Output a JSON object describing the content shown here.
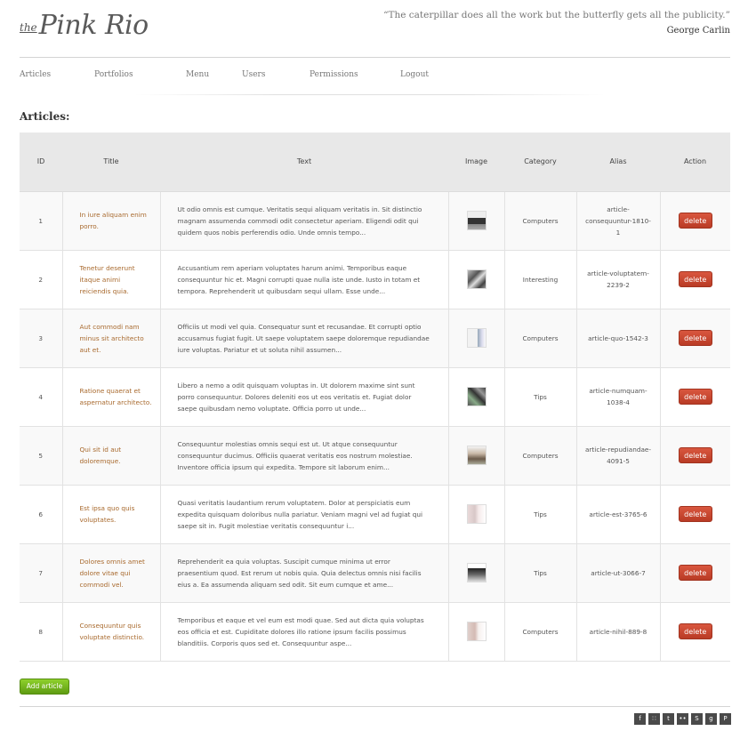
{
  "header": {
    "logo_prefix": "the",
    "logo_name": "Pink Rio",
    "quote": "“The caterpillar does all the work but the butterfly gets all the publicity.”",
    "quote_author": "George Carlin"
  },
  "nav": {
    "items": [
      {
        "label": "Articles"
      },
      {
        "label": "Portfolios"
      },
      {
        "label": "Menu"
      },
      {
        "label": "Users"
      },
      {
        "label": "Permissions"
      },
      {
        "label": "Logout"
      }
    ]
  },
  "page_title": "Articles:",
  "table": {
    "headers": [
      "ID",
      "Title",
      "Text",
      "Image",
      "Category",
      "Alias",
      "Action"
    ],
    "rows": [
      {
        "id": "1",
        "title": "In iure aliquam enim porro.",
        "text": "Ut odio omnis est cumque. Veritatis sequi aliquam veritatis in. Sit distinctio magnam assumenda commodi odit consectetur aperiam. Eligendi odit qui quidem quos nobis perferendis odio. Unde omnis tempo...",
        "category": "Computers",
        "alias": "article-consequuntur-1810-1",
        "action": "delete"
      },
      {
        "id": "2",
        "title": "Tenetur deserunt itaque animi reiciendis quia.",
        "text": "Accusantium rem aperiam voluptates harum animi. Temporibus eaque consequuntur hic et. Magni corrupti quae nulla iste unde. Iusto in totam et tempora. Reprehenderit ut quibusdam sequi ullam. Esse unde...",
        "category": "Interesting",
        "alias": "article-voluptatem-2239-2",
        "action": "delete"
      },
      {
        "id": "3",
        "title": "Aut commodi nam minus sit architecto aut et.",
        "text": "Officiis ut modi vel quia. Consequatur sunt et recusandae. Et corrupti optio accusamus fugiat fugit. Ut saepe voluptatem saepe doloremque repudiandae iure voluptas. Pariatur et ut soluta nihil assumen...",
        "category": "Computers",
        "alias": "article-quo-1542-3",
        "action": "delete"
      },
      {
        "id": "4",
        "title": "Ratione quaerat et aspernatur architecto.",
        "text": "Libero a nemo a odit quisquam voluptas in. Ut dolorem maxime sint sunt porro consequuntur. Dolores deleniti eos ut eos veritatis et. Fugiat dolor saepe quibusdam nemo voluptate. Officia porro ut unde...",
        "category": "Tips",
        "alias": "article-numquam-1038-4",
        "action": "delete"
      },
      {
        "id": "5",
        "title": "Qui sit id aut doloremque.",
        "text": "Consequuntur molestias omnis sequi est ut. Ut atque consequuntur consequuntur ducimus. Officiis quaerat veritatis eos nostrum molestiae. Inventore officia ipsum qui expedita. Tempore sit laborum enim...",
        "category": "Computers",
        "alias": "article-repudiandae-4091-5",
        "action": "delete"
      },
      {
        "id": "6",
        "title": "Est ipsa quo quis voluptates.",
        "text": "Quasi veritatis laudantium rerum voluptatem. Dolor at perspiciatis eum expedita quisquam doloribus nulla pariatur. Veniam magni vel ad fugiat qui saepe sit in. Fugit molestiae veritatis consequuntur i...",
        "category": "Tips",
        "alias": "article-est-3765-6",
        "action": "delete"
      },
      {
        "id": "7",
        "title": "Dolores omnis amet dolore vitae qui commodi vel.",
        "text": "Reprehenderit ea quia voluptas. Suscipit cumque minima ut error praesentium quod. Est rerum ut nobis quia. Quia delectus omnis nisi facilis eius a. Ea assumenda aliquam sed odit. Sit eum cumque et ame...",
        "category": "Tips",
        "alias": "article-ut-3066-7",
        "action": "delete"
      },
      {
        "id": "8",
        "title": "Consequuntur quis voluptate distinctio.",
        "text": "Temporibus et eaque et vel eum est modi quae. Sed aut dicta quia voluptas eos officia et est. Cupiditate dolores illo ratione ipsum facilis possimus blanditiis. Corporis quos sed et. Consequuntur aspe...",
        "category": "Computers",
        "alias": "article-nihil-889-8",
        "action": "delete"
      }
    ]
  },
  "add_button": "Add article",
  "social": [
    {
      "icon": "facebook-icon",
      "glyph": "f"
    },
    {
      "icon": "rss-icon",
      "glyph": "∷"
    },
    {
      "icon": "twitter-icon",
      "glyph": "t"
    },
    {
      "icon": "flickr-icon",
      "glyph": "••"
    },
    {
      "icon": "skype-icon",
      "glyph": "S"
    },
    {
      "icon": "google-plus-icon",
      "glyph": "g"
    },
    {
      "icon": "pinterest-icon",
      "glyph": "P"
    }
  ],
  "colors": {
    "title_link": "#a8692d",
    "delete_button": "#c9462f",
    "add_button": "#76b51f",
    "header_row": "#e8e8e8"
  }
}
